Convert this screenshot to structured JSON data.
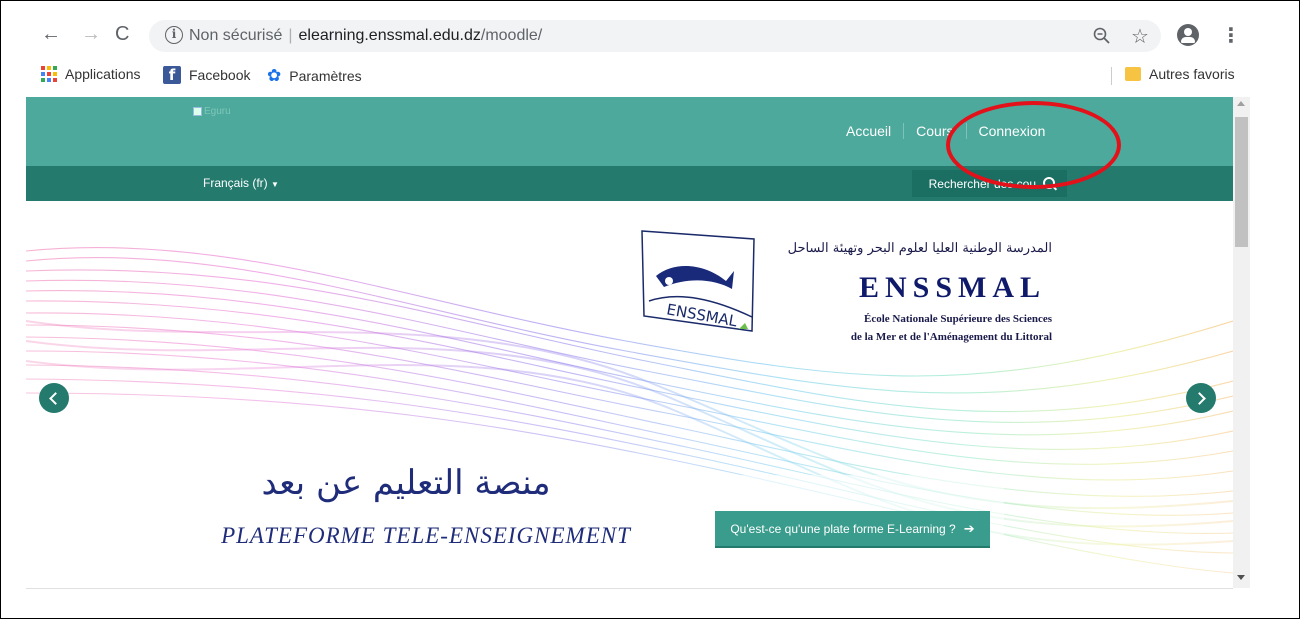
{
  "browser": {
    "url_prefix": "Non sécurisé",
    "url_host": "elearning.enssmal.edu.dz",
    "url_path": "/moodle/",
    "bookmarks": [
      {
        "label": "Applications",
        "icon": "apps-icon"
      },
      {
        "label": "Facebook",
        "icon": "facebook-icon"
      },
      {
        "label": "Paramètres",
        "icon": "gear-icon"
      }
    ],
    "other_bookmarks": "Autres favoris"
  },
  "site": {
    "logo_alt": "Eguru",
    "nav": [
      "Accueil",
      "Cours",
      "Connexion"
    ],
    "language": "Français (fr)",
    "search_placeholder": "Rechercher des cou"
  },
  "banner": {
    "arabic_school_name": "المدرسة الوطنية العليا لعلوم البحر وتهيئة الساحل",
    "acronym": "ENSSMAL",
    "school_line1": "École Nationale Supérieure des Sciences",
    "school_line2": "de la Mer et de l'Aménagement du Littoral",
    "logo_text": "ENSSMAL",
    "arabic_tagline": "منصة التعليم عن بعد",
    "french_tagline": "PLATEFORME TELE-ENSEIGNEMENT",
    "cta_label": "Qu'est-ce qu'une plate forme E-Learning ?"
  },
  "colors": {
    "header": "#4da99b",
    "subheader": "#237a6d",
    "annotation": "#e3111a"
  }
}
